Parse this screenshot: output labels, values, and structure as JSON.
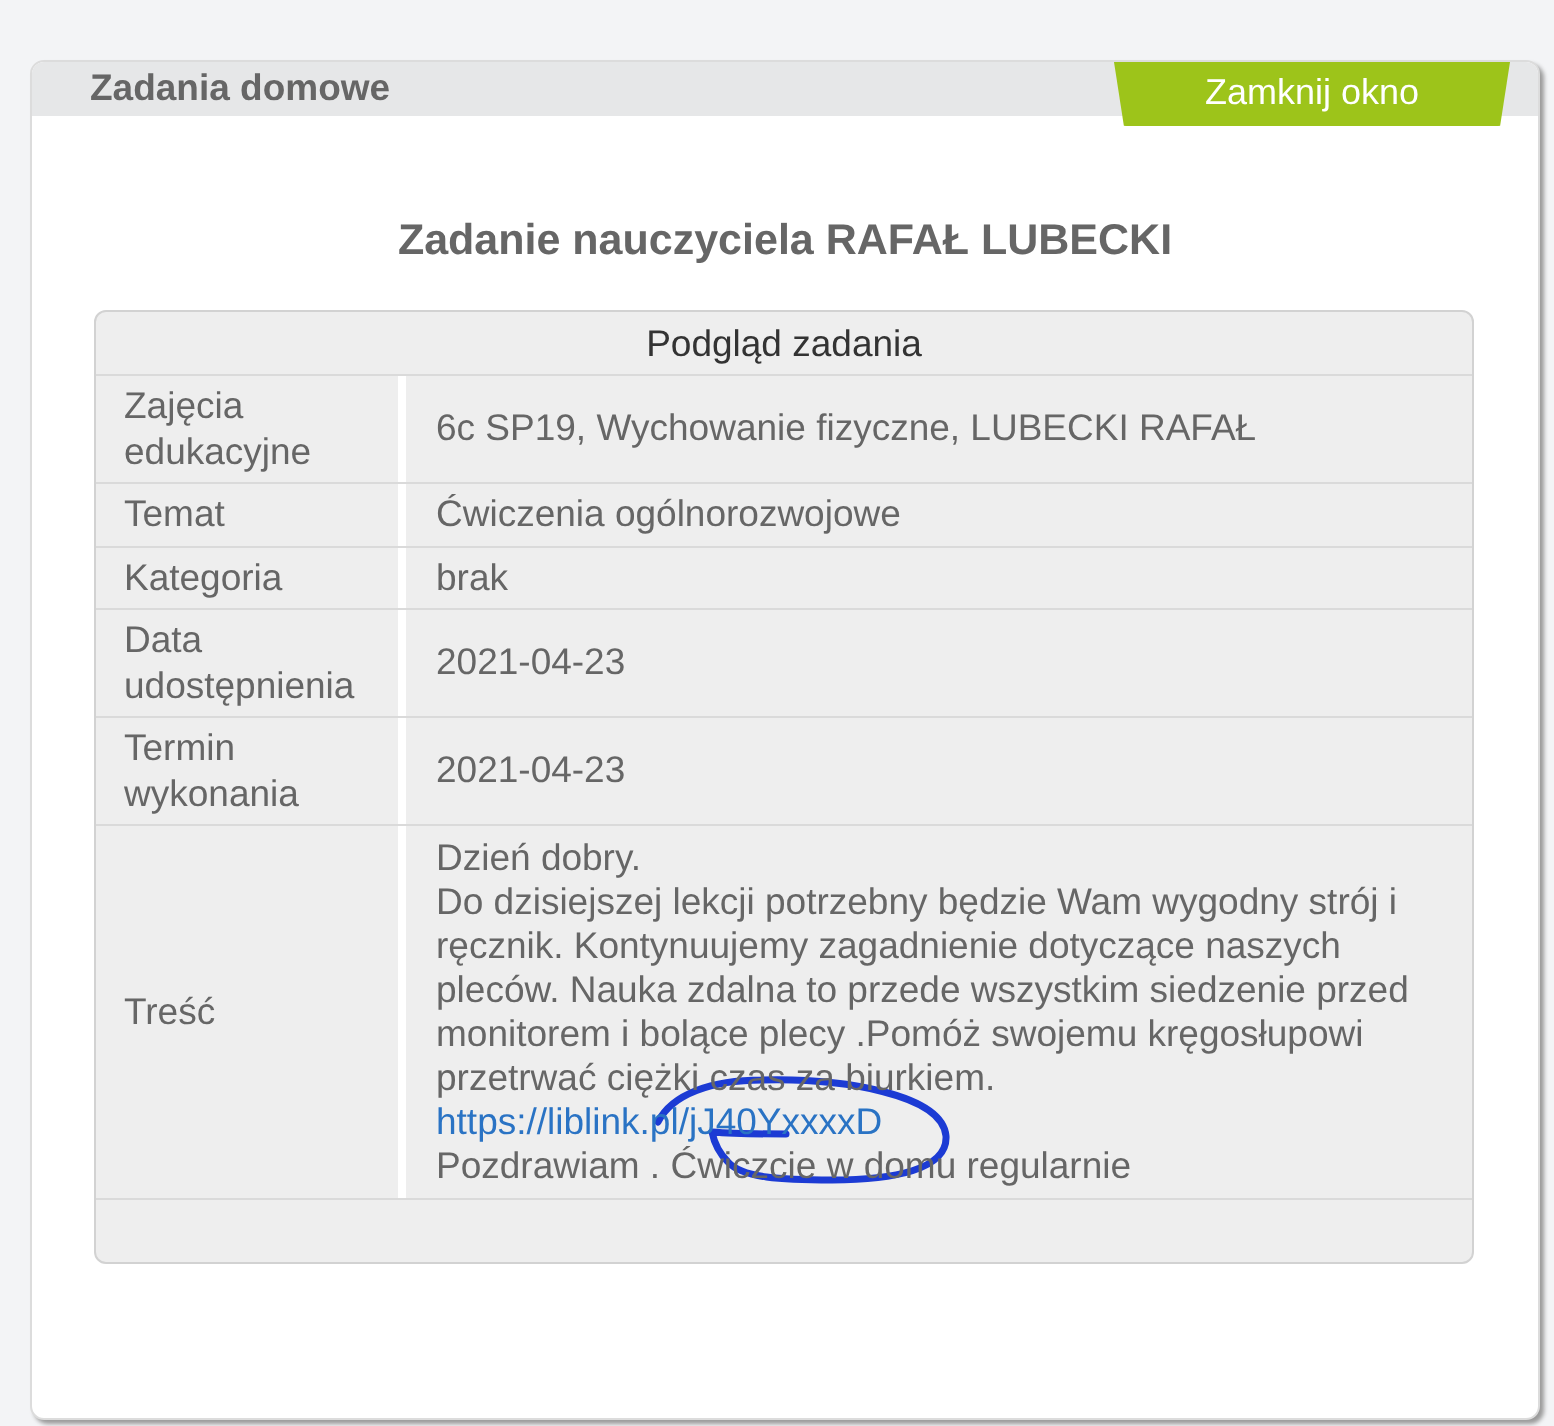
{
  "window": {
    "title": "Zadania domowe",
    "close_button": "Zamknij okno"
  },
  "heading": "Zadanie nauczyciela RAFAŁ LUBECKI",
  "table": {
    "caption": "Podgląd zadania",
    "rows": [
      {
        "kind": "text",
        "label": "Zajęcia edukacyjne",
        "value": "6c SP19, Wychowanie fizyczne, LUBECKI RAFAŁ"
      },
      {
        "kind": "text",
        "label": "Temat",
        "value": "Ćwiczenia ogólnorozwojowe"
      },
      {
        "kind": "text",
        "label": "Kategoria",
        "value": "brak"
      },
      {
        "kind": "text",
        "label": "Data udostępnienia",
        "value": "2021-04-23"
      },
      {
        "kind": "text",
        "label": "Termin wykonania",
        "value": "2021-04-23"
      },
      {
        "kind": "message",
        "label": "Treść",
        "parts": [
          {
            "kind": "text",
            "text": "Dzień dobry."
          },
          {
            "kind": "text",
            "text": "Do dzisiejszej lekcji potrzebny będzie Wam wygodny strój i ręcznik. Kontynuujemy zagadnienie dotyczące naszych pleców. Nauka zdalna to przede wszystkim siedzenie przed monitorem i bolące plecy .Pomóż swojemu kręgosłupowi przetrwać ciężki czas za biurkiem."
          },
          {
            "kind": "link",
            "text": "https://liblink.pl/jJ40YxxxxD"
          },
          {
            "kind": "text",
            "text": "Pozdrawiam . Ćwiczcie w domu regularnie"
          }
        ]
      }
    ]
  }
}
